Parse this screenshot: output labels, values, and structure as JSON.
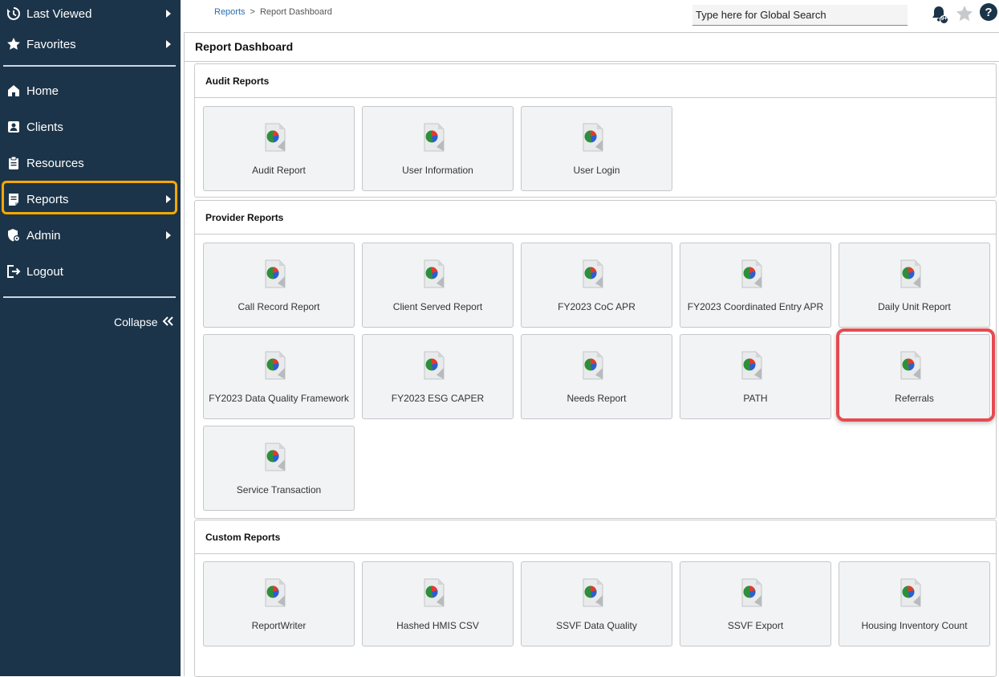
{
  "sidebar": {
    "last_viewed": "Last Viewed",
    "favorites": "Favorites",
    "home": "Home",
    "clients": "Clients",
    "resources": "Resources",
    "reports": "Reports",
    "admin": "Admin",
    "logout": "Logout",
    "collapse": "Collapse"
  },
  "topbar": {
    "breadcrumb": {
      "root": "Reports",
      "separator": ">",
      "current": "Report Dashboard"
    },
    "search_placeholder": "Type here for Global Search",
    "notification_badge": "9+"
  },
  "page": {
    "title": "Report Dashboard"
  },
  "sections": {
    "audit": {
      "title": "Audit Reports",
      "tiles": [
        "Audit Report",
        "User Information",
        "User Login"
      ]
    },
    "provider": {
      "title": "Provider Reports",
      "tiles": [
        "Call Record Report",
        "Client Served Report",
        "FY2023 CoC APR",
        "FY2023 Coordinated Entry APR",
        "Daily Unit Report",
        "FY2023 Data Quality Framework",
        "FY2023 ESG CAPER",
        "Needs Report",
        "PATH",
        "Referrals",
        "Service Transaction"
      ]
    },
    "custom": {
      "title": "Custom Reports",
      "tiles": [
        "ReportWriter",
        "Hashed HMIS CSV",
        "SSVF Data Quality",
        "SSVF Export",
        "Housing Inventory Count"
      ]
    }
  },
  "colors": {
    "sidebar_bg": "#1c3449",
    "active_outline": "#f5a800",
    "callout_red": "#e54b50"
  }
}
